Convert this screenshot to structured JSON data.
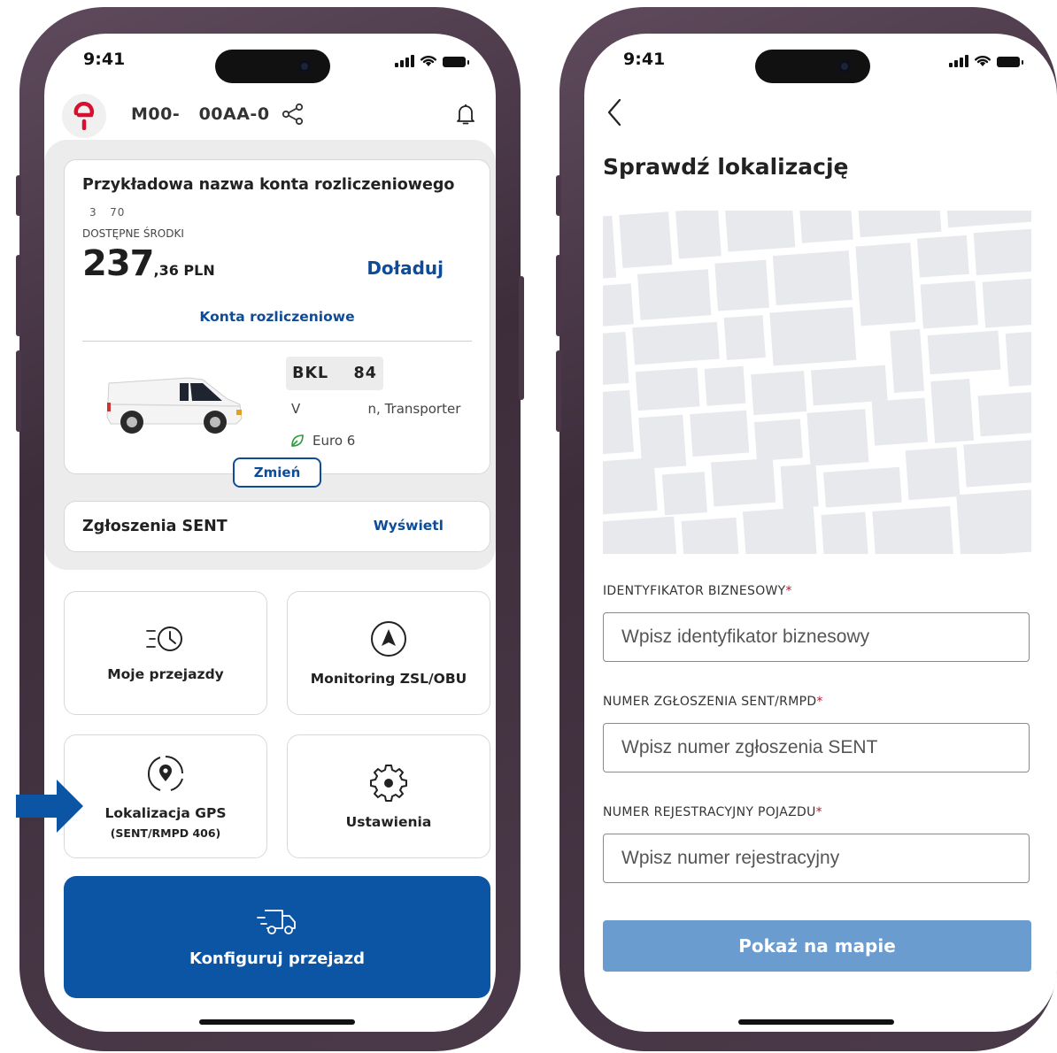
{
  "left_screen": {
    "status": {
      "time": "9:41"
    },
    "header": {
      "vehicle_plate": "M00-   00AA-0"
    },
    "account_card": {
      "title": "Przykładowa nazwa konta rozliczeniowego",
      "account_number": "3   70",
      "funds_label": "DOSTĘPNE ŚRODKI",
      "amount_main": "237",
      "amount_fraction": ",36 PLN",
      "topup_label": "Doładuj",
      "accounts_link": "Konta rozliczeniowe",
      "vehicle": {
        "plate": "BKL    84",
        "model": "V                n, Transporter",
        "emission": "Euro 6",
        "change_label": "Zmień"
      }
    },
    "sent_card": {
      "title": "Zgłoszenia SENT",
      "link": "Wyświetl"
    },
    "tiles": [
      {
        "label": "Moje przejazdy",
        "icon": "clock-speed-icon"
      },
      {
        "label": "Monitoring ZSL/OBU",
        "icon": "navigation-icon"
      },
      {
        "label": "Lokalizacja GPS",
        "sublabel": "(SENT/RMPD 406)",
        "icon": "location-pin-icon"
      },
      {
        "label": "Ustawienia",
        "icon": "gear-icon"
      }
    ],
    "config_button": {
      "label": "Konfiguruj przejazd",
      "icon": "truck-icon"
    },
    "colors": {
      "accent": "#0f4c97",
      "primary_button": "#0c55a4",
      "logo": "#d6102f"
    }
  },
  "right_screen": {
    "status": {
      "time": "9:41"
    },
    "title": "Sprawdź lokalizację",
    "fields": [
      {
        "label": "IDENTYFIKATOR BIZNESOWY",
        "required_mark": "*",
        "placeholder": "Wpisz identyfikator biznesowy"
      },
      {
        "label": "NUMER ZGŁOSZENIA SENT/RMPD",
        "required_mark": "*",
        "placeholder": "Wpisz numer zgłoszenia SENT"
      },
      {
        "label": "NUMER REJESTRACYJNY POJAZDU",
        "required_mark": "*",
        "placeholder": "Wpisz numer rejestracyjny"
      }
    ],
    "submit_label": "Pokaż na mapie",
    "colors": {
      "submit_disabled": "#6a9ccf",
      "required": "#c8102e"
    }
  }
}
